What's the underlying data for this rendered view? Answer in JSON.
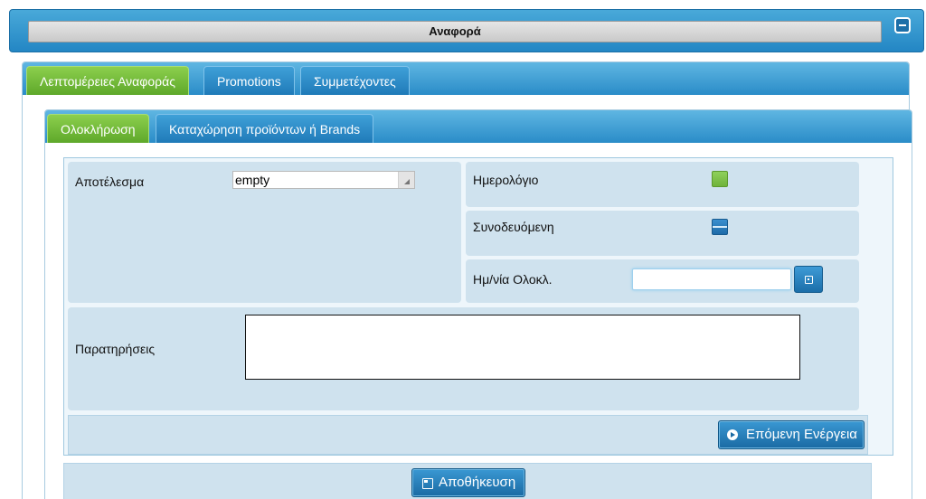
{
  "window": {
    "title": "Αναφορά",
    "collapse_icon": "minus-icon"
  },
  "outer_tabs": [
    {
      "label": "Λεπτομέρειες Αναφοράς",
      "active": true
    },
    {
      "label": "Promotions",
      "active": false
    },
    {
      "label": "Συμμετέχοντες",
      "active": false
    }
  ],
  "inner_tabs": [
    {
      "label": "Ολοκλήρωση",
      "active": true
    },
    {
      "label": "Καταχώρηση προϊόντων ή Brands",
      "active": false
    }
  ],
  "form": {
    "result_label": "Αποτέλεσμα",
    "result_value": "empty",
    "calendar_label": "Ημερολόγιο",
    "calendar_checked": true,
    "attached_label": "Συνοδευόμενη",
    "attached_checked": true,
    "completion_date_label": "Ημ/νία Ολοκλ.",
    "completion_date_value": "",
    "notes_label": "Παρατηρήσεις",
    "notes_value": ""
  },
  "actions": {
    "next_label": "Επόμενη Ενέργεια",
    "save_label": "Αποθήκευση"
  },
  "colors": {
    "accent_blue": "#2386c4",
    "active_tab_green": "#6fb33a"
  }
}
